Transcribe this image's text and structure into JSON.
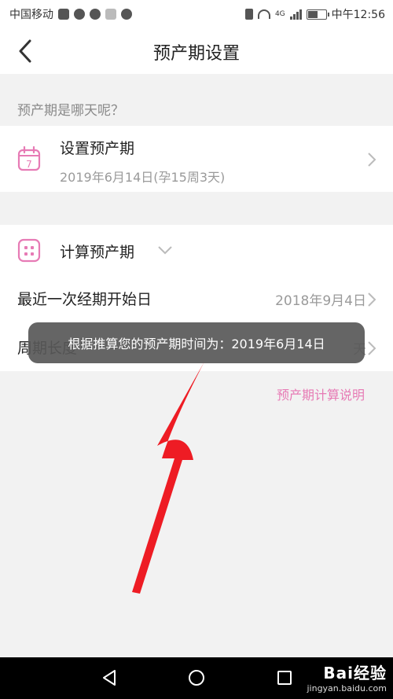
{
  "status_bar": {
    "carrier": "中国移动",
    "network": "4G",
    "time": "中午12:56",
    "battery_level": 0.55
  },
  "header": {
    "title": "预产期设置",
    "back_icon": "chevron-left-icon"
  },
  "question": "预产期是哪天呢？",
  "set_due_date": {
    "icon": "calendar-7-icon",
    "calendar_day": "7",
    "title": "设置预产期",
    "subtitle": "2019年6月14日(孕15周3天)"
  },
  "calculate": {
    "icon": "calendar-grid-icon",
    "title": "计算预产期",
    "expand_icon": "chevron-down-icon",
    "last_period_label": "最近一次经期开始日",
    "last_period_value": "2018年9月4日",
    "cycle_label": "周期长度",
    "cycle_value": "天"
  },
  "explain_link": "预产期计算说明",
  "toast": "根据推算您的预产期时间为：2019年6月14日",
  "watermark": {
    "logo": "Bai经验",
    "url": "jingyan.baidu.com"
  },
  "colors": {
    "accent": "#e77bb5",
    "annotation": "#ee1c24",
    "toast_bg": "#585858"
  }
}
